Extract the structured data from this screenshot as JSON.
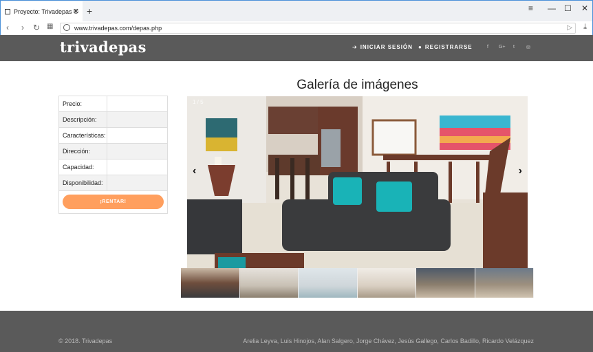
{
  "browser": {
    "tab_title": "Proyecto: Trivadepas ©",
    "tab_close": "✕",
    "new_tab": "+",
    "url": "www.trivadepas.com/depas.php"
  },
  "header": {
    "brand": "trivadepas",
    "login": "INICIAR SESIÓN",
    "register": "REGISTRARSE",
    "social_icons": [
      "facebook-icon",
      "google-plus-icon",
      "twitter-icon",
      "mail-icon"
    ],
    "social_glyphs": [
      "f",
      "G+",
      "t",
      "✉"
    ]
  },
  "info_table": {
    "rows": [
      {
        "label": "Precio:"
      },
      {
        "label": "Descripción:"
      },
      {
        "label": "Características:"
      },
      {
        "label": "Dirección:"
      },
      {
        "label": "Capacidad:"
      },
      {
        "label": "Disponibilidad:"
      }
    ],
    "rent_button": "¡RENTAR!"
  },
  "gallery": {
    "title": "Galería de imágenes",
    "counter": "1 / 5",
    "prev": "‹",
    "next": "›",
    "thumbnail_count": 6
  },
  "footer": {
    "copyright": "© 2018. Trivadepas",
    "credits": "Arelia Leyva, Luis Hinojos, Alan Salgero, Jorge Chávez, Jesús Gallego, Carlos Badillo, Ricardo Velázquez"
  },
  "colors": {
    "header_bg": "#5a5a5a",
    "accent": "#ff9f5e",
    "sofa": "#3a3b3d",
    "pillow": "#19b3b7"
  }
}
